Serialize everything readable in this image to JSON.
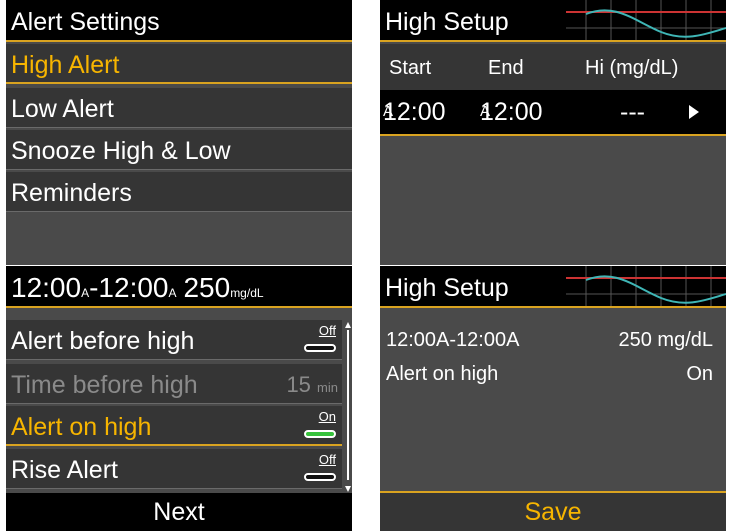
{
  "screen1": {
    "title": "Alert Settings",
    "items": [
      "High Alert",
      "Low Alert",
      "Snooze High & Low",
      "Reminders"
    ]
  },
  "screen2": {
    "title": "High Setup",
    "headers": {
      "start": "Start",
      "end": "End",
      "hi": "Hi (mg/dL)"
    },
    "row": {
      "start": "12:00",
      "start_ampm": "A",
      "end": "12:00",
      "end_ampm": "A",
      "value": "---"
    }
  },
  "screen3": {
    "title": {
      "start": "12:00",
      "start_ampm": "A",
      "sep": "-",
      "end": "12:00",
      "end_ampm": "A",
      "value": "250",
      "unit": "mg/dL"
    },
    "rows": [
      {
        "label": "Alert before high",
        "toggle": "Off"
      },
      {
        "label": "Time before high",
        "value": "15",
        "unit": "min"
      },
      {
        "label": "Alert on high",
        "toggle": "On"
      },
      {
        "label": "Rise Alert",
        "toggle": "Off"
      }
    ],
    "next_label": "Next"
  },
  "screen4": {
    "title": "High Setup",
    "range": "12:00A-12:00A",
    "value": "250 mg/dL",
    "alert_label": "Alert on high",
    "alert_value": "On",
    "save_label": "Save"
  },
  "colors": {
    "accent": "#f7b500",
    "toggle_on": "#37c23c",
    "background": "#4a4a4a"
  }
}
